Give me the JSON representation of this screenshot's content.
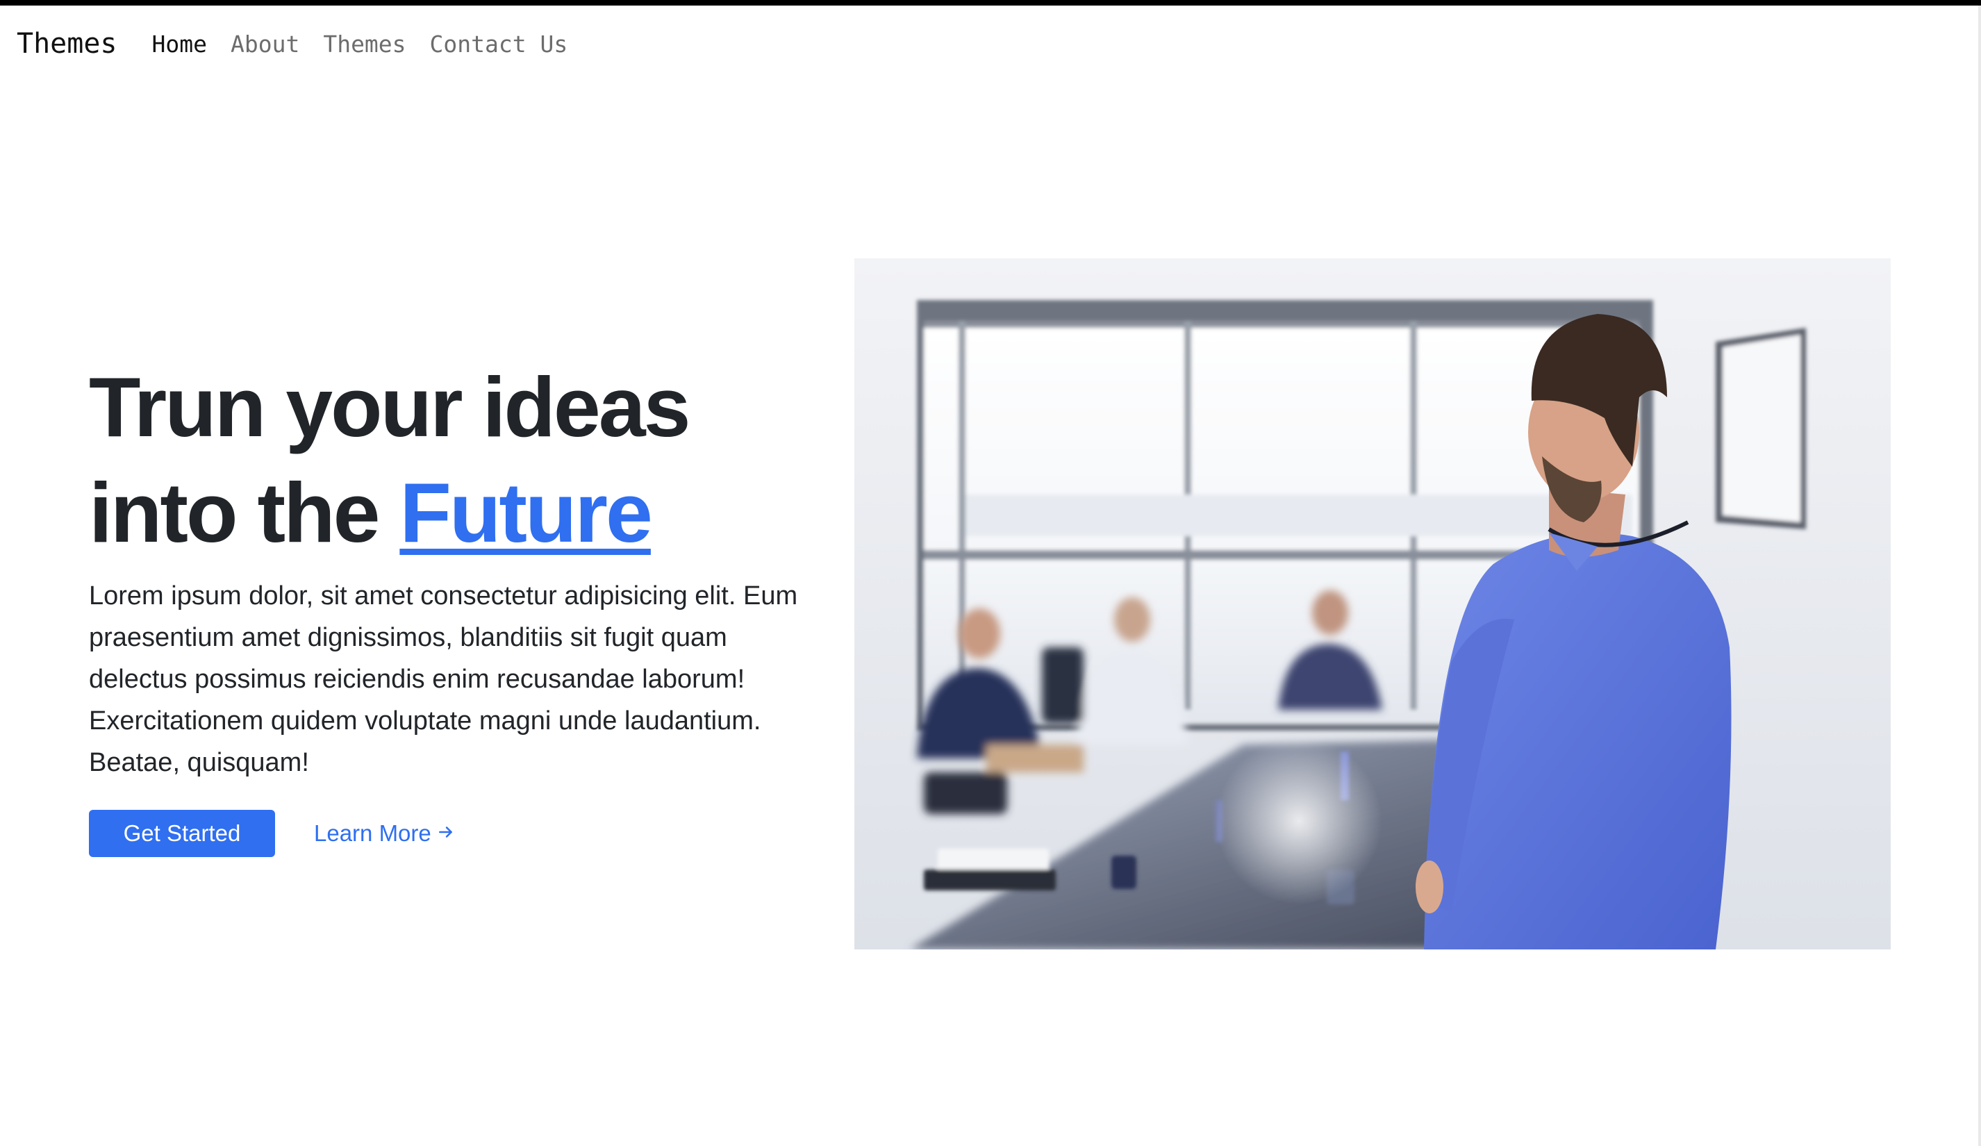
{
  "navbar": {
    "brand": "Themes",
    "links": [
      {
        "label": "Home",
        "active": true
      },
      {
        "label": "About",
        "active": false
      },
      {
        "label": "Themes",
        "active": false
      },
      {
        "label": "Contact Us",
        "active": false
      }
    ]
  },
  "hero": {
    "title_line1": "Trun your ideas",
    "title_line2_prefix": "into the ",
    "title_highlight": "Future",
    "description": "Lorem ipsum dolor, sit amet consectetur adipisicing elit. Eum praesentium amet dignissimos, blanditiis sit fugit quam delectus possimus reiciendis enim recusandae laborum! Exercitationem quidem voluptate magni unde laudantium. Beatae, quisquam!",
    "primary_button": "Get Started",
    "secondary_link": "Learn More",
    "secondary_icon": "arrow-right-icon",
    "image_alt": "business-meeting-photo"
  },
  "colors": {
    "accent": "#2f6ff0",
    "text": "#212529",
    "nav_muted": "#6c6c6c"
  }
}
